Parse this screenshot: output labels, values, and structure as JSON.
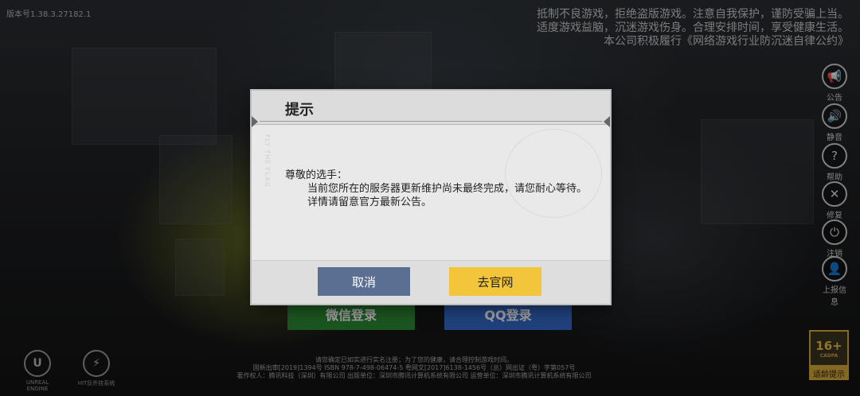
{
  "version": "版本号1.38.3.27182.1",
  "notice_lines": [
    "抵制不良游戏，拒绝盗版游戏。注意自我保护，谨防受骗上当。",
    "适度游戏益脑，沉迷游戏伤身。合理安排时间，享受健康生活。",
    "本公司积极履行《网络游戏行业防沉迷自律公约》"
  ],
  "side_buttons": [
    {
      "icon": "megaphone-icon",
      "label": "公告"
    },
    {
      "icon": "speaker-icon",
      "label": "静音"
    },
    {
      "icon": "help-icon",
      "label": "帮助"
    },
    {
      "icon": "repair-icon",
      "label": "修复"
    },
    {
      "icon": "power-icon",
      "label": "注销"
    },
    {
      "icon": "user-icon",
      "label": "上报信息"
    }
  ],
  "login": {
    "wechat": "微信登录",
    "qq": "QQ登录"
  },
  "logos": [
    {
      "mark": "U",
      "label": "UNREAL ENGINE"
    },
    {
      "mark": "⚡",
      "label": "HIT反外挂系统"
    }
  ],
  "footer_lines": [
    "请您确定已如实进行实名注册；为了您的健康，请合理控制游戏时间。",
    "国新出审[2019]1394号  ISBN 978-7-498-06474-5  粤网文[2017]6138-1456号（总）网出证（粤）字第057号",
    "著作权人：腾讯科技（深圳）有限公司  出版单位：深圳市腾讯计算机系统有限公司  运营单位：深圳市腾讯计算机系统有限公司"
  ],
  "age": {
    "rating": "16+",
    "org": "CADPA",
    "caption": "适龄提示"
  },
  "dialog": {
    "title": "提示",
    "watermark": "FLY THE FLAG",
    "greeting": "尊敬的选手：",
    "body": "当前您所在的服务器更新维护尚未最终完成，请您耐心等待。详情请留意官方最新公告。",
    "cancel_label": "取消",
    "confirm_label": "去官网"
  }
}
